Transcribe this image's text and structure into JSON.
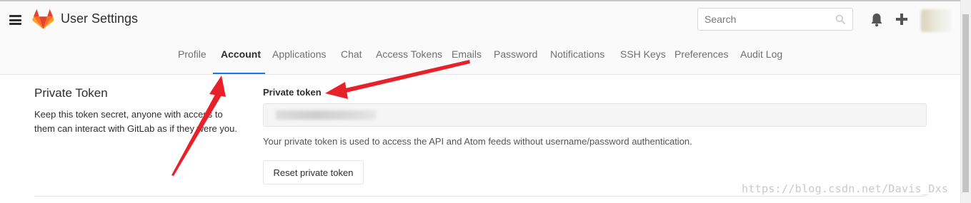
{
  "header": {
    "title": "User Settings",
    "search_placeholder": "Search",
    "brand_color": "#fc6d26"
  },
  "nav": {
    "tabs": [
      {
        "label": "Profile"
      },
      {
        "label": "Account",
        "active": true
      },
      {
        "label": "Applications"
      },
      {
        "label": "Chat"
      },
      {
        "label": "Access Tokens"
      },
      {
        "label": "Emails"
      },
      {
        "label": "Password"
      },
      {
        "label": "Notifications"
      },
      {
        "label": "SSH Keys"
      },
      {
        "label": "Preferences"
      },
      {
        "label": "Audit Log"
      }
    ],
    "active_color": "#1f78d1"
  },
  "private_token": {
    "section_title": "Private Token",
    "section_description": "Keep this token secret, anyone with access to them can interact with GitLab as if they were you.",
    "field_label": "Private token",
    "help_text": "Your private token is used to access the API and Atom feeds without username/password authentication.",
    "reset_label": "Reset private token"
  },
  "watermark": "https://blog.csdn.net/Davis_Dxs",
  "annotation_color": "#e8202a"
}
